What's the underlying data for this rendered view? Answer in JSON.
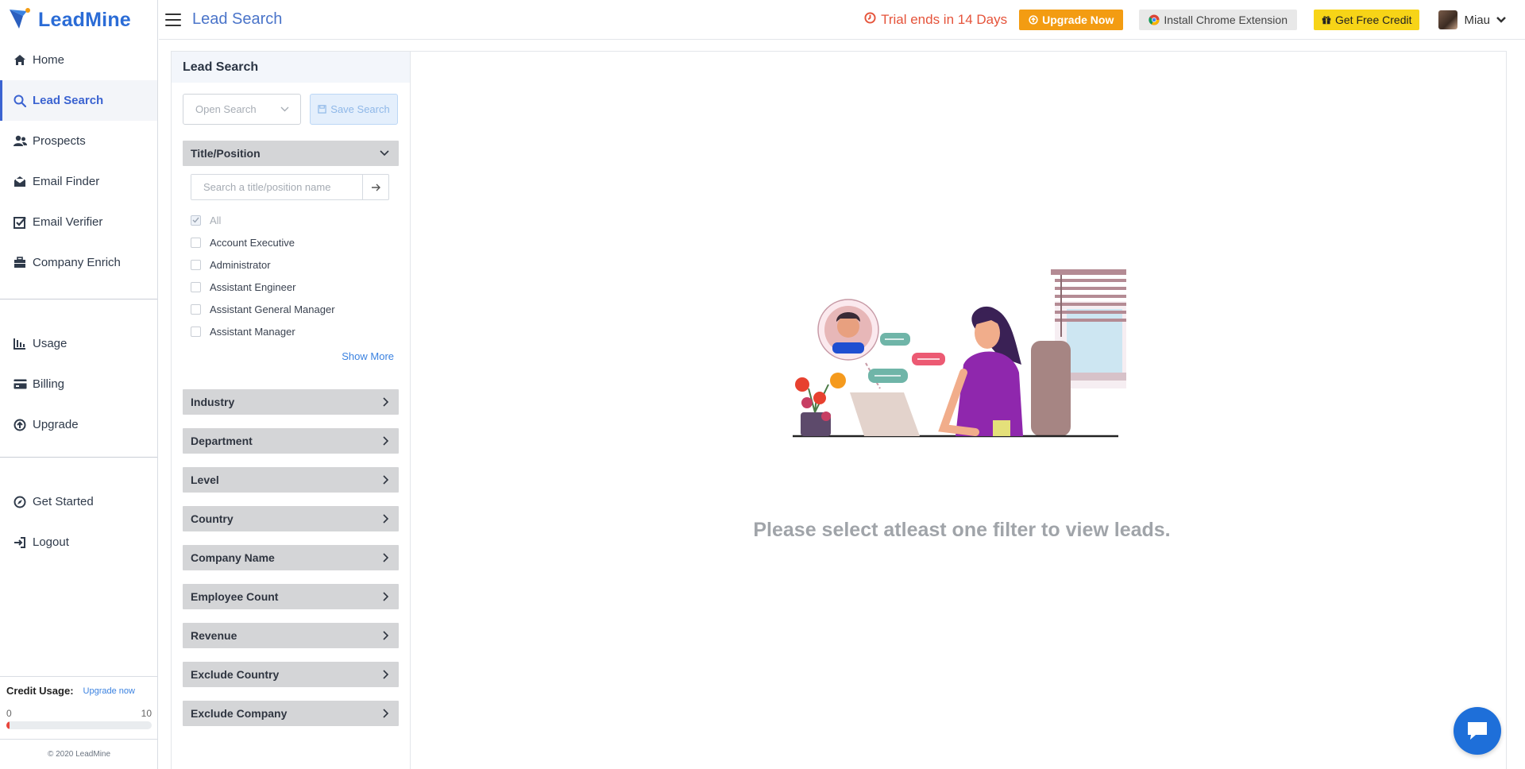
{
  "app": {
    "name": "LeadMine"
  },
  "sidebar": {
    "items": [
      {
        "label": "Home",
        "icon": "home-icon"
      },
      {
        "label": "Lead Search",
        "icon": "search-icon",
        "active": true
      },
      {
        "label": "Prospects",
        "icon": "users-icon"
      },
      {
        "label": "Email Finder",
        "icon": "envelope-open-icon"
      },
      {
        "label": "Email Verifier",
        "icon": "check-square-icon"
      },
      {
        "label": "Company Enrich",
        "icon": "briefcase-icon"
      }
    ],
    "items2": [
      {
        "label": "Usage",
        "icon": "chart-icon"
      },
      {
        "label": "Billing",
        "icon": "credit-card-icon"
      },
      {
        "label": "Upgrade",
        "icon": "arrow-circle-up-icon"
      }
    ],
    "items3": [
      {
        "label": "Get Started",
        "icon": "compass-icon"
      },
      {
        "label": "Logout",
        "icon": "logout-icon"
      }
    ],
    "credit": {
      "label": "Credit Usage:",
      "link": "Upgrade now",
      "min": "0",
      "max": "10",
      "used_fraction": 0.02,
      "bar_color": "#e8453c"
    },
    "copyright": "© 2020 LeadMine"
  },
  "topbar": {
    "title": "Lead Search",
    "trial": "Trial ends in 14 Days",
    "upgrade": "Upgrade Now",
    "chrome": "Install Chrome Extension",
    "free_credit": "Get Free Credit",
    "user": "Miau"
  },
  "filters": {
    "heading": "Lead Search",
    "open_search_placeholder": "Open Search",
    "save_search": "Save Search",
    "title_position": {
      "label": "Title/Position",
      "search_placeholder": "Search a title/position name",
      "options": [
        {
          "label": "All",
          "checked": true
        },
        {
          "label": "Account Executive",
          "checked": false
        },
        {
          "label": "Administrator",
          "checked": false
        },
        {
          "label": "Assistant Engineer",
          "checked": false
        },
        {
          "label": "Assistant General Manager",
          "checked": false
        },
        {
          "label": "Assistant Manager",
          "checked": false
        }
      ],
      "show_more": "Show More"
    },
    "sections": [
      "Industry",
      "Department",
      "Level",
      "Country",
      "Company Name",
      "Employee Count",
      "Revenue",
      "Exclude Country",
      "Exclude Company"
    ]
  },
  "empty_state": {
    "message": "Please select atleast one filter to view leads."
  },
  "colors": {
    "brand": "#2b6cd6",
    "accent": "#3b63d1",
    "trial": "#e5533a",
    "upgrade": "#f39c12",
    "credit_btn": "#f7d417"
  }
}
